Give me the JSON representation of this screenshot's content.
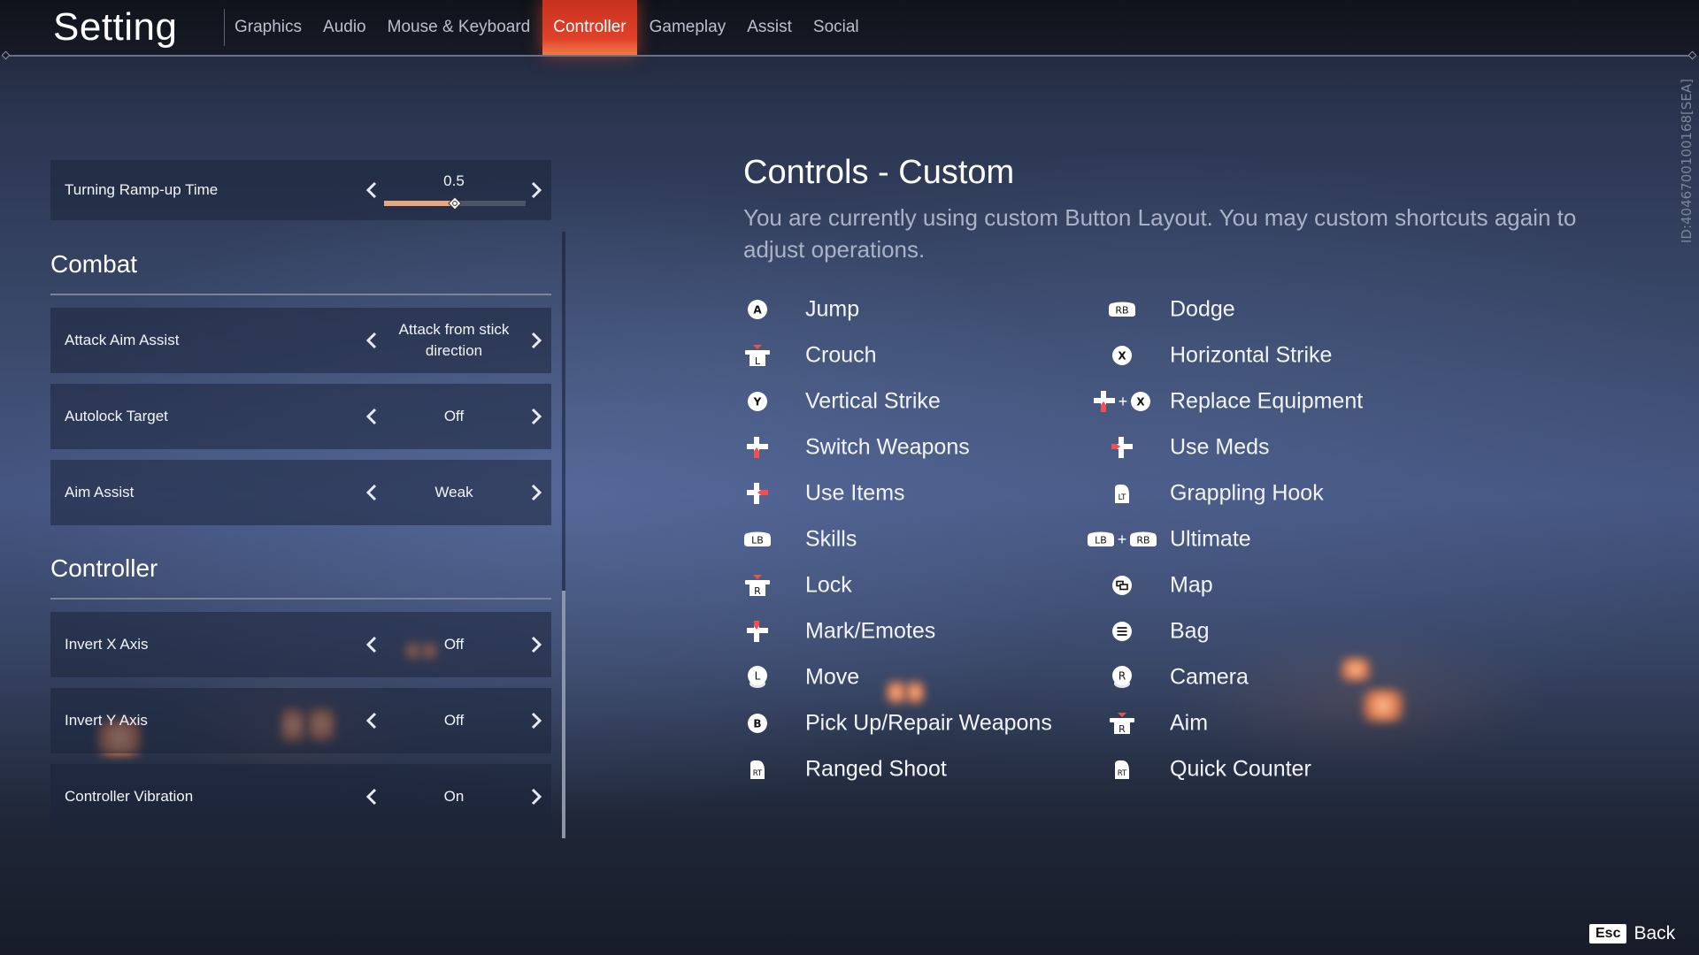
{
  "header": {
    "title": "Setting",
    "tabs": [
      {
        "label": "Graphics",
        "active": false
      },
      {
        "label": "Audio",
        "active": false
      },
      {
        "label": "Mouse & Keyboard",
        "active": false
      },
      {
        "label": "Controller",
        "active": true
      },
      {
        "label": "Gameplay",
        "active": false
      },
      {
        "label": "Assist",
        "active": false
      },
      {
        "label": "Social",
        "active": false
      }
    ],
    "accent_color": "#e0412a"
  },
  "player_id": "ID:4046700100168[SEA]",
  "settings": {
    "turning_ramp": {
      "label": "Turning Ramp-up Time",
      "value": "0.5",
      "slider_fraction": 0.5,
      "slider_color": "#eaa77e"
    },
    "combat": {
      "title": "Combat",
      "rows": [
        {
          "label": "Attack Aim Assist",
          "value": "Attack from stick direction"
        },
        {
          "label": "Autolock Target",
          "value": "Off"
        },
        {
          "label": "Aim Assist",
          "value": "Weak"
        }
      ]
    },
    "controller": {
      "title": "Controller",
      "rows": [
        {
          "label": "Invert X Axis",
          "value": "Off"
        },
        {
          "label": "Invert Y Axis",
          "value": "Off"
        },
        {
          "label": "Controller Vibration",
          "value": "On"
        }
      ]
    },
    "scroll_position_fraction": 1.0
  },
  "controls": {
    "title": "Controls - Custom",
    "description": "You are currently using custom Button Layout. You may custom shortcuts again to adjust operations.",
    "column1": [
      {
        "action": "Jump",
        "buttons": [
          "A"
        ]
      },
      {
        "action": "Crouch",
        "buttons": [
          "L-stick-press"
        ]
      },
      {
        "action": "Vertical Strike",
        "buttons": [
          "Y"
        ]
      },
      {
        "action": "Switch Weapons",
        "buttons": [
          "dpad-down"
        ]
      },
      {
        "action": "Use Items",
        "buttons": [
          "dpad-right"
        ]
      },
      {
        "action": "Skills",
        "buttons": [
          "LB"
        ]
      },
      {
        "action": "Lock",
        "buttons": [
          "R-stick-press"
        ]
      },
      {
        "action": "Mark/Emotes",
        "buttons": [
          "dpad-up"
        ]
      },
      {
        "action": "Move",
        "buttons": [
          "L-stick"
        ]
      },
      {
        "action": "Pick Up/Repair Weapons",
        "buttons": [
          "B"
        ]
      },
      {
        "action": "Ranged Shoot",
        "buttons": [
          "RT"
        ]
      }
    ],
    "column2": [
      {
        "action": "Dodge",
        "buttons": [
          "RB"
        ]
      },
      {
        "action": "Horizontal Strike",
        "buttons": [
          "X"
        ]
      },
      {
        "action": "Replace Equipment",
        "buttons": [
          "dpad-down",
          "X"
        ]
      },
      {
        "action": "Use Meds",
        "buttons": [
          "dpad-left"
        ]
      },
      {
        "action": "Grappling Hook",
        "buttons": [
          "LT"
        ]
      },
      {
        "action": "Ultimate",
        "buttons": [
          "LB",
          "RB"
        ]
      },
      {
        "action": "Map",
        "buttons": [
          "view"
        ]
      },
      {
        "action": "Bag",
        "buttons": [
          "menu"
        ]
      },
      {
        "action": "Camera",
        "buttons": [
          "R-stick"
        ]
      },
      {
        "action": "Aim",
        "buttons": [
          "R-stick-press"
        ]
      },
      {
        "action": "Quick Counter",
        "buttons": [
          "RT"
        ]
      }
    ],
    "combo_separator": "+",
    "highlight_color": "#f05050"
  },
  "footer": {
    "key": "Esc",
    "label": "Back"
  }
}
